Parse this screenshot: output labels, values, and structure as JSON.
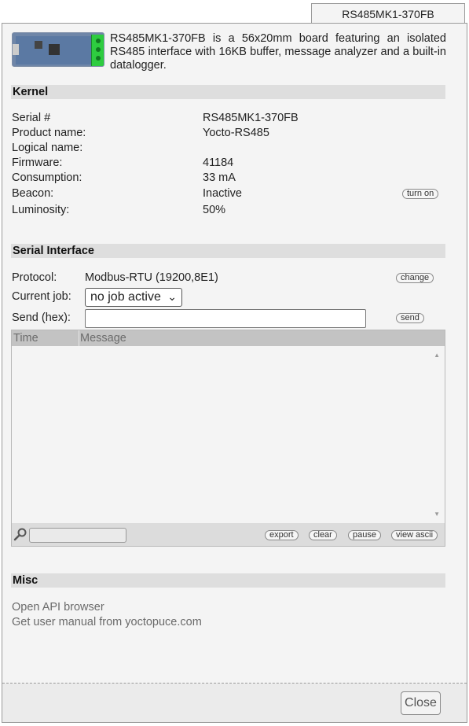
{
  "tab": {
    "title": "RS485MK1-370FB"
  },
  "description": "RS485MK1-370FB is a 56x20mm board featuring an isolated RS485 interface with 16KB buffer, message analyzer and a built-in datalogger.",
  "kernel": {
    "heading": "Kernel",
    "rows": [
      {
        "label": "Serial #",
        "value": "RS485MK1-370FB"
      },
      {
        "label": "Product name:",
        "value": "Yocto-RS485"
      },
      {
        "label": "Logical name:",
        "value": ""
      },
      {
        "label": "Firmware:",
        "value": "41184"
      },
      {
        "label": "Consumption:",
        "value": "33 mA"
      },
      {
        "label": "Beacon:",
        "value": "Inactive"
      },
      {
        "label": "Luminosity:",
        "value": "50%"
      }
    ],
    "beacon_button": "turn on"
  },
  "serial": {
    "heading": "Serial Interface",
    "protocol_label": "Protocol:",
    "protocol_value": "Modbus-RTU (19200,8E1)",
    "change_button": "change",
    "job_label": "Current job:",
    "job_value": "no job active",
    "send_label": "Send (hex):",
    "send_value": "",
    "send_button": "send",
    "columns": [
      "Time",
      "Message"
    ],
    "filter_value": "",
    "buttons": {
      "export": "export",
      "clear": "clear",
      "pause": "pause",
      "view_ascii": "view ascii"
    }
  },
  "misc": {
    "heading": "Misc",
    "links": [
      "Open API browser",
      "Get user manual from yoctopuce.com"
    ]
  },
  "footer": {
    "close_label": "Close"
  }
}
